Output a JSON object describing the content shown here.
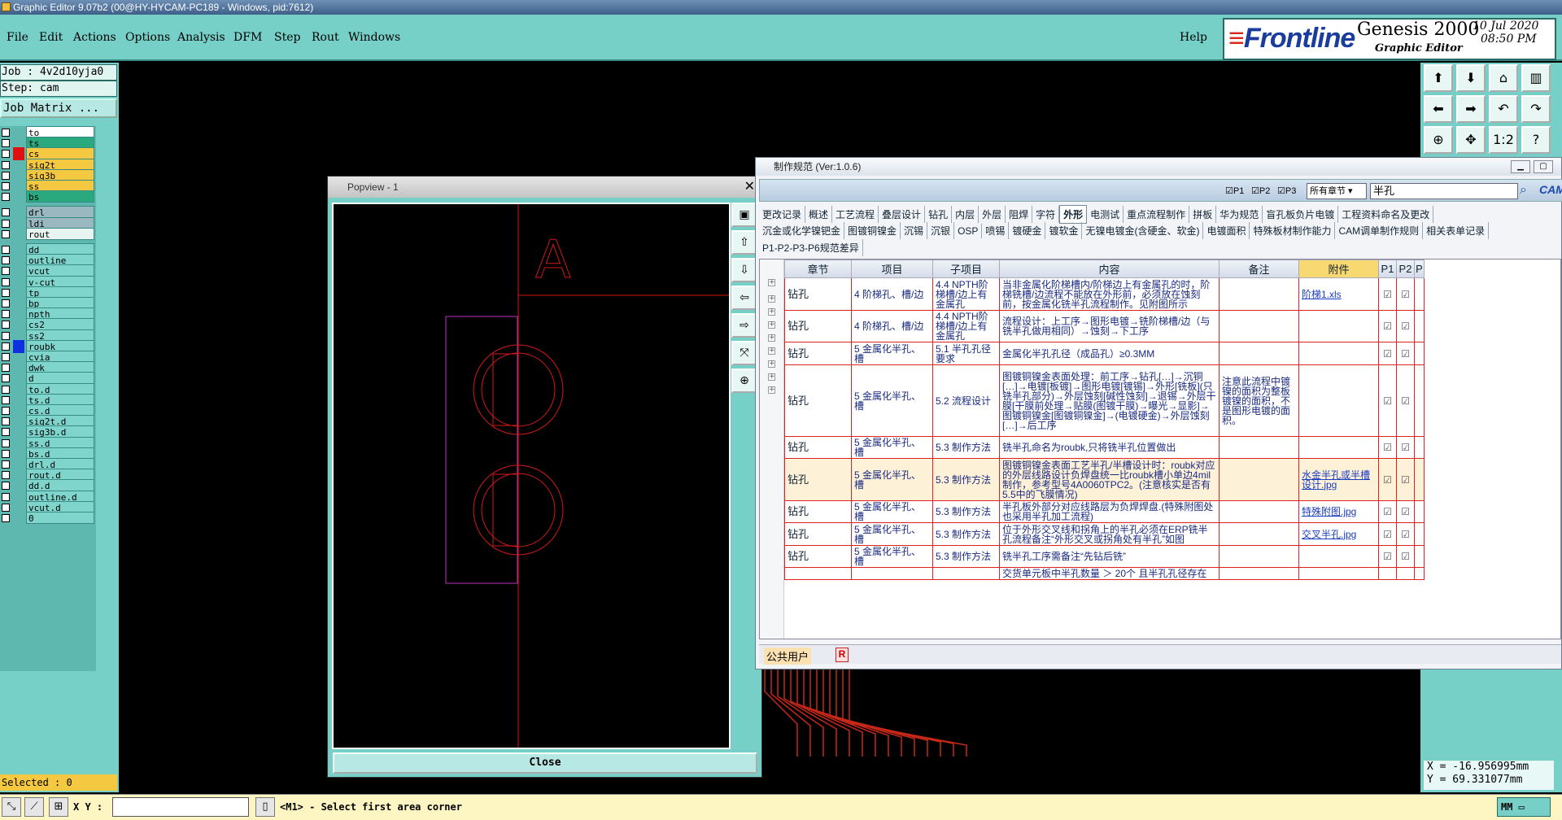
{
  "app": {
    "title": "Graphic Editor 9.07b2 (00@HY-HYCAM-PC189 - Windows, pid:7612)"
  },
  "menu": {
    "items": [
      "File",
      "Edit",
      "Actions",
      "Options",
      "Analysis",
      "DFM",
      "Step",
      "Rout",
      "Windows"
    ],
    "help": "Help"
  },
  "brand": {
    "logo": "Frontline",
    "product": "Genesis 2000",
    "subtitle": "Graphic Editor",
    "date": "10 Jul 2020",
    "time": "08:50 PM"
  },
  "left": {
    "job": "Job : 4v2d10yja0",
    "step": "Step: cam",
    "job_matrix": "Job Matrix ...",
    "selected": "Selected : 0"
  },
  "layers": [
    {
      "name": "to",
      "color": "#ffffff",
      "mark": ""
    },
    {
      "name": "ts",
      "color": "#2aa87e",
      "mark": ""
    },
    {
      "name": "cs",
      "color": "#f5c842",
      "mark": "#e01010"
    },
    {
      "name": "sig2t",
      "color": "#f5c842",
      "mark": ""
    },
    {
      "name": "sig3b",
      "color": "#f5c842",
      "mark": ""
    },
    {
      "name": "ss",
      "color": "#f5c842",
      "mark": ""
    },
    {
      "name": "bs",
      "color": "#2aa87e",
      "mark": ""
    },
    {
      "name": "drl",
      "color": "#9ab8c0",
      "mark": ""
    },
    {
      "name": "ldi",
      "color": "#9ab8c0",
      "mark": ""
    },
    {
      "name": "rout",
      "color": "#e8f4f2",
      "mark": ""
    },
    {
      "name": "dd",
      "color": "#7fd4cc",
      "mark": ""
    },
    {
      "name": "outline",
      "color": "#7fd4cc",
      "mark": ""
    },
    {
      "name": "vcut",
      "color": "#7fd4cc",
      "mark": ""
    },
    {
      "name": "v-cut",
      "color": "#7fd4cc",
      "mark": ""
    },
    {
      "name": "tp",
      "color": "#7fd4cc",
      "mark": ""
    },
    {
      "name": "bp",
      "color": "#7fd4cc",
      "mark": ""
    },
    {
      "name": "npth",
      "color": "#7fd4cc",
      "mark": ""
    },
    {
      "name": "cs2",
      "color": "#7fd4cc",
      "mark": ""
    },
    {
      "name": "ss2",
      "color": "#7fd4cc",
      "mark": ""
    },
    {
      "name": "roubk",
      "color": "#7fd4cc",
      "mark": "#1030e0"
    },
    {
      "name": "cvia",
      "color": "#7fd4cc",
      "mark": ""
    },
    {
      "name": "dwk",
      "color": "#7fd4cc",
      "mark": ""
    },
    {
      "name": "d",
      "color": "#7fd4cc",
      "mark": ""
    },
    {
      "name": "to.d",
      "color": "#7fd4cc",
      "mark": ""
    },
    {
      "name": "ts.d",
      "color": "#7fd4cc",
      "mark": ""
    },
    {
      "name": "cs.d",
      "color": "#7fd4cc",
      "mark": ""
    },
    {
      "name": "sig2t.d",
      "color": "#7fd4cc",
      "mark": ""
    },
    {
      "name": "sig3b.d",
      "color": "#7fd4cc",
      "mark": ""
    },
    {
      "name": "ss.d",
      "color": "#7fd4cc",
      "mark": ""
    },
    {
      "name": "bs.d",
      "color": "#7fd4cc",
      "mark": ""
    },
    {
      "name": "drl.d",
      "color": "#7fd4cc",
      "mark": ""
    },
    {
      "name": "rout.d",
      "color": "#7fd4cc",
      "mark": ""
    },
    {
      "name": "dd.d",
      "color": "#7fd4cc",
      "mark": ""
    },
    {
      "name": "outline.d",
      "color": "#7fd4cc",
      "mark": ""
    },
    {
      "name": "vcut.d",
      "color": "#7fd4cc",
      "mark": ""
    },
    {
      "name": "0",
      "color": "#7fd4cc",
      "mark": ""
    }
  ],
  "popview": {
    "title": "Popview - 1",
    "close": "Close",
    "close_x": "✕",
    "label_letter": "A"
  },
  "coords": {
    "x": "X = -16.956995mm",
    "y": "Y = 69.331077mm"
  },
  "status": {
    "xy_label": "X Y :",
    "message": "<M1> - Select first area corner",
    "unit": "MM"
  },
  "spec": {
    "title": "制作规范 (Ver:1.0.6)",
    "filters": [
      "P1",
      "P2",
      "P3"
    ],
    "chapter_select": "所有章节",
    "search_value": "半孔",
    "cam_logo": "CAM",
    "tabs_row1": [
      "更改记录",
      "概述",
      "工艺流程",
      "叠层设计",
      "钻孔",
      "内层",
      "外层",
      "阻焊",
      "字符",
      "外形",
      "电测试",
      "重点流程制作",
      "拼板",
      "华为规范",
      "盲孔板负片电镀",
      "工程资料命名及更改"
    ],
    "active_tab": "外形",
    "tabs_row2": [
      "沉金或化学镍钯金",
      "图镀铜镍金",
      "沉锡",
      "沉银",
      "OSP",
      "喷锡",
      "镀硬金",
      "镀软金",
      "无镍电镀金(含硬金、软金)",
      "电镀面积",
      "特殊板材制作能力",
      "CAM调单制作规则",
      "相关表单记录"
    ],
    "tabs_row3": [
      "P1-P2-P3-P6规范差异"
    ],
    "headers": [
      "章节",
      "项目",
      "子项目",
      "内容",
      "备注",
      "附件",
      "P1",
      "P2",
      "P"
    ],
    "rows": [
      {
        "chapter": "钻孔",
        "item": "4 阶梯孔、槽/边",
        "sub": "4.4 NPTH阶梯槽/边上有金属孔",
        "content": "当非金属化阶梯槽内/阶梯边上有金属孔的时，阶梯铣槽/边流程不能放在外形前，必须放在蚀刻前，按金属化铣半孔流程制作。见附图所示",
        "note": "",
        "attach": "阶梯1.xls",
        "p1": "☑",
        "p2": "☑"
      },
      {
        "chapter": "钻孔",
        "item": "4 阶梯孔、槽/边",
        "sub": "4.4 NPTH阶梯槽/边上有金属孔",
        "content": "流程设计：上工序→图形电镀→铣阶梯槽/边（与铣半孔做用相同）→蚀刻→下工序",
        "note": "",
        "attach": "",
        "p1": "☑",
        "p2": "☑"
      },
      {
        "chapter": "钻孔",
        "item": "5 金属化半孔、槽",
        "sub": "5.1 半孔孔径要求",
        "content": "金属化半孔孔径（成品孔）≥0.3MM",
        "note": "",
        "attach": "",
        "p1": "☑",
        "p2": "☑"
      },
      {
        "chapter": "钻孔",
        "item": "5 金属化半孔、槽",
        "sub": "5.2 流程设计",
        "content": "图镀铜镍金表面处理：前工序→钻孔[…]→沉铜[…]→电镀[板镀]→图形电镀[镀锡]→外形[铣板](只铣半孔部分)→外层蚀刻[碱性蚀刻]→退锡→外层干膜[干膜前处理→贴膜(图镀干膜)→曝光→显影]→图镀铜镍金[图镀铜镍金]→(电镀硬金)→外层蚀刻[…]→后工序",
        "note": "注意此流程中镀镍的面积为整板镀镍的面积，不是图形电镀的面积。",
        "attach": "",
        "p1": "☑",
        "p2": "☑"
      },
      {
        "chapter": "钻孔",
        "item": "5 金属化半孔、槽",
        "sub": "5.3 制作方法",
        "content": "铣半孔命名为roubk,只将铣半孔位置做出",
        "note": "",
        "attach": "",
        "p1": "☑",
        "p2": "☑"
      },
      {
        "chapter": "钻孔",
        "item": "5 金属化半孔、槽",
        "sub": "5.3 制作方法",
        "content": "图镀铜镍金表面工艺半孔/半槽设计时：roubk对应的外层线路设计负焊盘统一比roubk槽小单边4mil制作，参考型号4A0060TPC2。(注意核实是否有5.5中的飞膜情况)",
        "note": "",
        "attach": "水金半孔或半槽设计.jpg",
        "p1": "☑",
        "p2": "☑"
      },
      {
        "chapter": "钻孔",
        "item": "5 金属化半孔、槽",
        "sub": "5.3 制作方法",
        "content": "半孔板外部分对应线路层为负焊焊盘.(特殊附图处也采用半孔加工流程)",
        "note": "",
        "attach": "特殊附图.jpg",
        "p1": "☑",
        "p2": "☑"
      },
      {
        "chapter": "钻孔",
        "item": "5 金属化半孔、槽",
        "sub": "5.3 制作方法",
        "content": "位于外形交叉线和拐角上的半孔必须在ERP铣半孔流程备注“外形交叉或拐角处有半孔”如图",
        "note": "",
        "attach": "交叉半孔.jpg",
        "p1": "☑",
        "p2": "☑"
      },
      {
        "chapter": "钻孔",
        "item": "5 金属化半孔、槽",
        "sub": "5.3 制作方法",
        "content": "铣半孔工序需备注“先钻后铣”",
        "note": "",
        "attach": "",
        "p1": "☑",
        "p2": "☑"
      },
      {
        "chapter": "",
        "item": "",
        "sub": "",
        "content": "交货单元板中半孔数量 ＞ 20个 且半孔孔径存在",
        "note": "",
        "attach": "",
        "p1": "",
        "p2": ""
      }
    ],
    "footer_user": "公共用户",
    "footer_badge": "R"
  }
}
